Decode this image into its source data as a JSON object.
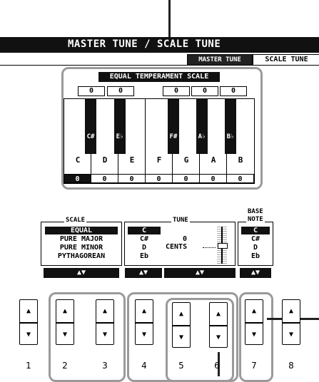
{
  "header": {
    "title": "MASTER TUNE / SCALE TUNE"
  },
  "tabs": [
    {
      "label": "MASTER TUNE",
      "active": false
    },
    {
      "label": "SCALE TUNE",
      "active": true
    }
  ],
  "scale_box": {
    "label": "EQUAL TEMPERAMENT SCALE",
    "black_cents": [
      "0",
      "0",
      "0",
      "0",
      "0"
    ],
    "black_keys": [
      "C#",
      "E♭",
      "F#",
      "A♭",
      "B♭"
    ],
    "white_keys": [
      "C",
      "D",
      "E",
      "F",
      "G",
      "A",
      "B"
    ],
    "white_cents": [
      "0",
      "0",
      "0",
      "0",
      "0",
      "0",
      "0"
    ]
  },
  "scale_panel": {
    "title": "SCALE",
    "options": [
      "EQUAL",
      "PURE MAJOR",
      "PURE MINOR",
      "PYTHAGOREAN"
    ],
    "selected": "EQUAL",
    "arrows": "▲▼"
  },
  "tune_panel": {
    "title": "TUNE",
    "notes": [
      "C",
      "C#",
      "D",
      "Eb"
    ],
    "selected_note": "C",
    "value": "0",
    "unit": "CENTS",
    "note_arrows": "▲▼",
    "value_arrows": "▲▼"
  },
  "base_note_panel": {
    "title_line1": "BASE",
    "title_line2": "NOTE",
    "notes": [
      "C",
      "C#",
      "D",
      "Eb"
    ],
    "selected": "C",
    "arrows": "▲▼"
  },
  "hardware_buttons": {
    "labels": [
      "1",
      "2",
      "3",
      "4",
      "5",
      "6",
      "7",
      "8"
    ],
    "up_symbol": "▲",
    "down_symbol": "▼"
  }
}
